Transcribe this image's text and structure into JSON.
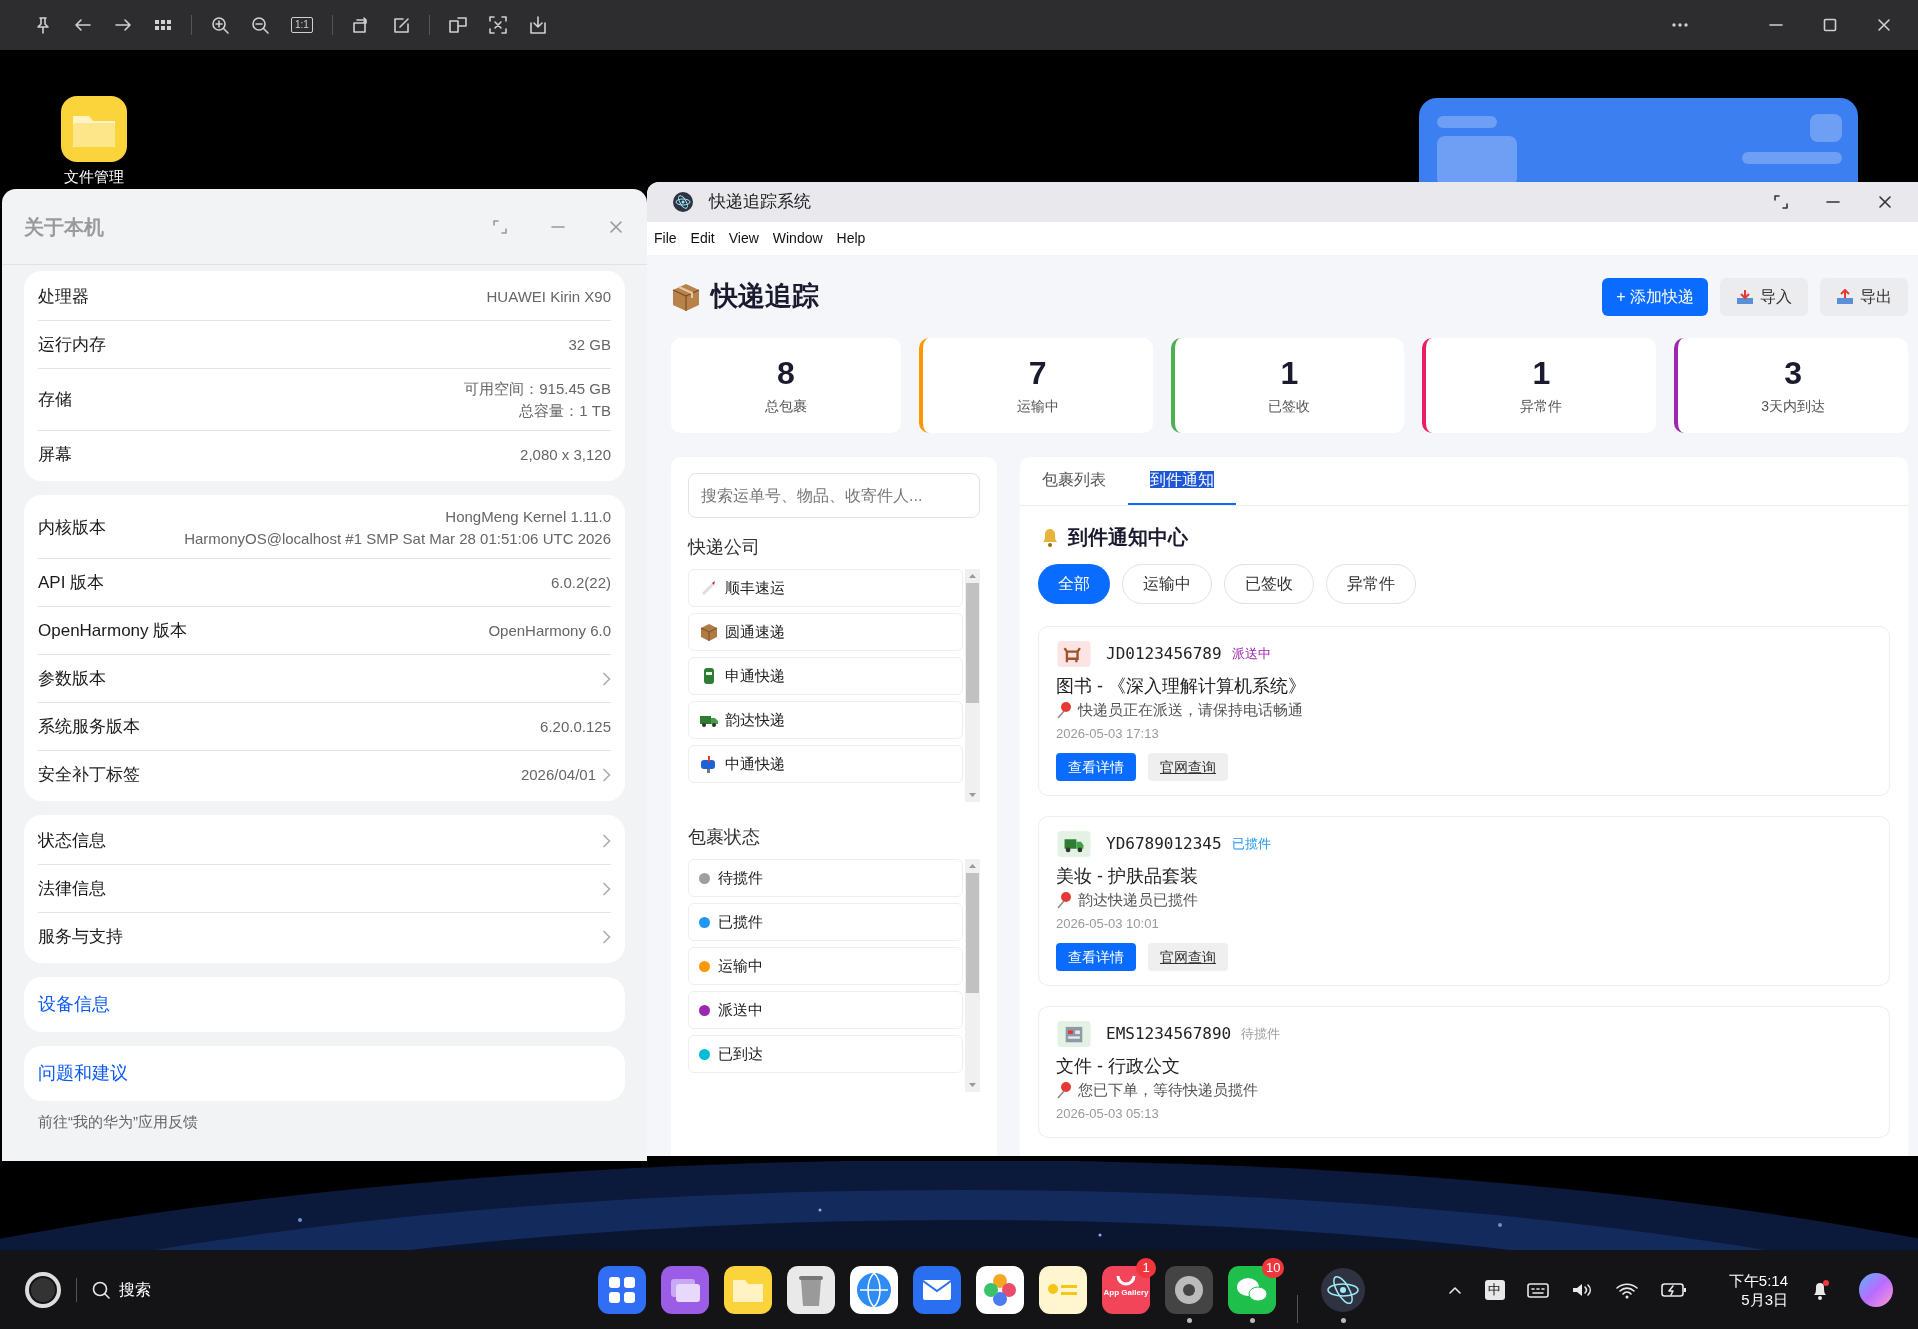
{
  "viewer_toolbar": {
    "ratio_label": "1:1"
  },
  "desktop": {
    "icon_label": "文件管理"
  },
  "about_window": {
    "title": "关于本机",
    "groups": [
      [
        {
          "label": "处理器",
          "values": [
            "HUAWEI Kirin X90"
          ],
          "chevron": false
        },
        {
          "label": "运行内存",
          "values": [
            "32 GB"
          ],
          "chevron": false
        },
        {
          "label": "存储",
          "values": [
            "可用空间：915.45 GB",
            "总容量：1 TB"
          ],
          "chevron": false
        },
        {
          "label": "屏幕",
          "values": [
            "2,080 x 3,120"
          ],
          "chevron": false
        }
      ],
      [
        {
          "label": "内核版本",
          "values": [
            "HongMeng Kernel 1.11.0",
            "HarmonyOS@localhost #1 SMP Sat Mar 28 01:51:06 UTC 2026"
          ],
          "chevron": false
        },
        {
          "label": "API 版本",
          "values": [
            "6.0.2(22)"
          ],
          "chevron": false
        },
        {
          "label": "OpenHarmony 版本",
          "values": [
            "OpenHarmony 6.0"
          ],
          "chevron": false
        },
        {
          "label": "参数版本",
          "chevron": true
        },
        {
          "label": "系统服务版本",
          "values": [
            "6.20.0.125"
          ],
          "chevron": false
        },
        {
          "label": "安全补丁标签",
          "values": [
            "2026/04/01"
          ],
          "chevron": true
        }
      ],
      [
        {
          "label": "状态信息",
          "chevron": true
        },
        {
          "label": "法律信息",
          "chevron": true
        },
        {
          "label": "服务与支持",
          "chevron": true
        }
      ]
    ],
    "links": [
      "设备信息",
      "问题和建议"
    ],
    "footnote": "前往“我的华为”应用反馈"
  },
  "express_window": {
    "title": "快递追踪系统",
    "menu": [
      "File",
      "Edit",
      "View",
      "Window",
      "Help"
    ],
    "header": {
      "title": "快递追踪",
      "buttons": [
        {
          "label": "+ 添加快递",
          "kind": "primary"
        },
        {
          "label": "导入",
          "kind": "import"
        },
        {
          "label": "导出",
          "kind": "export"
        }
      ]
    },
    "stats": [
      {
        "value": "8",
        "label": "总包裹"
      },
      {
        "value": "7",
        "label": "运输中",
        "color": "#ff9800"
      },
      {
        "value": "1",
        "label": "已签收",
        "color": "#4caf50"
      },
      {
        "value": "1",
        "label": "异常件",
        "color": "#e91e63"
      },
      {
        "value": "3",
        "label": "3天内到达",
        "color": "#9c27b0"
      }
    ],
    "filter_panel": {
      "search": {
        "placeholder": "搜索运单号、物品、收寄件人..."
      },
      "companies_title": "快递公司",
      "companies": [
        {
          "name": "顺丰速运"
        },
        {
          "name": "圆通速递"
        },
        {
          "name": "申通快递"
        },
        {
          "name": "韵达快递"
        },
        {
          "name": "中通快递"
        }
      ],
      "statuses_title": "包裹状态",
      "statuses": [
        {
          "label": "待揽件",
          "color": "#9e9e9e"
        },
        {
          "label": "已揽件",
          "color": "#2196f3"
        },
        {
          "label": "运输中",
          "color": "#ff9800"
        },
        {
          "label": "派送中",
          "color": "#9c27b0"
        },
        {
          "label": "已到达",
          "color": "#00bcd4"
        }
      ]
    },
    "tabs": [
      {
        "label": "包裹列表",
        "selected": false
      },
      {
        "label": "到件通知",
        "selected": true
      }
    ],
    "notice_center": {
      "title": "到件通知中心",
      "filters": [
        {
          "label": "全部",
          "selected": true
        },
        {
          "label": "运输中",
          "selected": false
        },
        {
          "label": "已签收",
          "selected": false
        },
        {
          "label": "异常件",
          "selected": false
        }
      ],
      "notices": [
        {
          "icon": {
            "color": "#fde4e4"
          },
          "number": "JD0123456789",
          "status": {
            "label": "派送中",
            "color": "#9c27b0"
          },
          "title": "图书 - 《深入理解计算机系统》",
          "message": "快递员正在派送，请保持电话畅通",
          "time": "2026-05-03 17:13",
          "actions": [
            "查看详情",
            "官网查询"
          ]
        },
        {
          "icon": {
            "color": "#e3f2e5"
          },
          "number": "YD6789012345",
          "status": {
            "label": "已揽件",
            "color": "#2196f3"
          },
          "title": "美妆 - 护肤品套装",
          "message": "韵达快递员已揽件",
          "time": "2026-05-03 10:01",
          "actions": [
            "查看详情",
            "官网查询"
          ]
        },
        {
          "icon": {
            "color": "#e3f2e5"
          },
          "number": "EMS1234567890",
          "status": {
            "label": "待揽件",
            "color": "#9e9e9e"
          },
          "title": "文件 - 行政公文",
          "message": "您已下单，等待快递员揽件",
          "time": "2026-05-03 05:13"
        }
      ]
    }
  },
  "taskbar": {
    "search_label": "搜索",
    "apps": [
      {
        "running": false
      },
      {
        "running": false
      },
      {
        "running": false
      },
      {
        "running": false
      },
      {
        "running": false
      },
      {
        "running": false
      },
      {
        "running": false
      },
      {
        "running": false
      },
      {
        "running": false,
        "badge": "1",
        "label": "App Gallery"
      },
      {
        "running": true
      },
      {
        "running": true,
        "badge": "10"
      },
      {
        "running": true
      }
    ],
    "input_method": "中",
    "time": "下午5:14",
    "date": "5月3日"
  }
}
